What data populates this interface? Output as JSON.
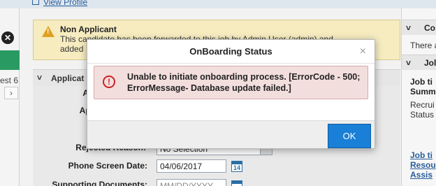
{
  "header": {
    "view_profile": "View Profile"
  },
  "left": {
    "close_icon": "close-circle-icon",
    "est_text": "est 6",
    "chevron": "›"
  },
  "warning": {
    "title": "Non Applicant",
    "line1": "This candidate has been forwarded to this job by Admin User (admin) and",
    "line2": "added"
  },
  "section": {
    "chevron": "˅",
    "label": "Applicat"
  },
  "form": {
    "label_a": "A",
    "label_app": "App",
    "rejected_label": "Rejected Reason:",
    "rejected_value": "No Selection",
    "phone_label": "Phone Screen Date:",
    "phone_value": "04/06/2017",
    "supporting_label": "Supporting Documents:",
    "supporting_value": "MM/DD/YYYY",
    "cal_day": "14"
  },
  "right": {
    "head1_chev": "˅",
    "head1_label": "Co",
    "there": "There a",
    "head2_chev": "˅",
    "head2_label": "Jol",
    "job_title1": "Job ti",
    "summ": "Summ",
    "recruit": "Recrui",
    "status": "Status",
    "link1": "Job ti",
    "link2": "Resou",
    "link3": "Assis"
  },
  "modal": {
    "title": "OnBoarding Status",
    "close": "×",
    "error_icon": "!",
    "error_message": "Unable to initiate onboarding process. [ErrorCode - 500; ErrorMessage- Database update failed.]",
    "ok_label": "OK"
  }
}
